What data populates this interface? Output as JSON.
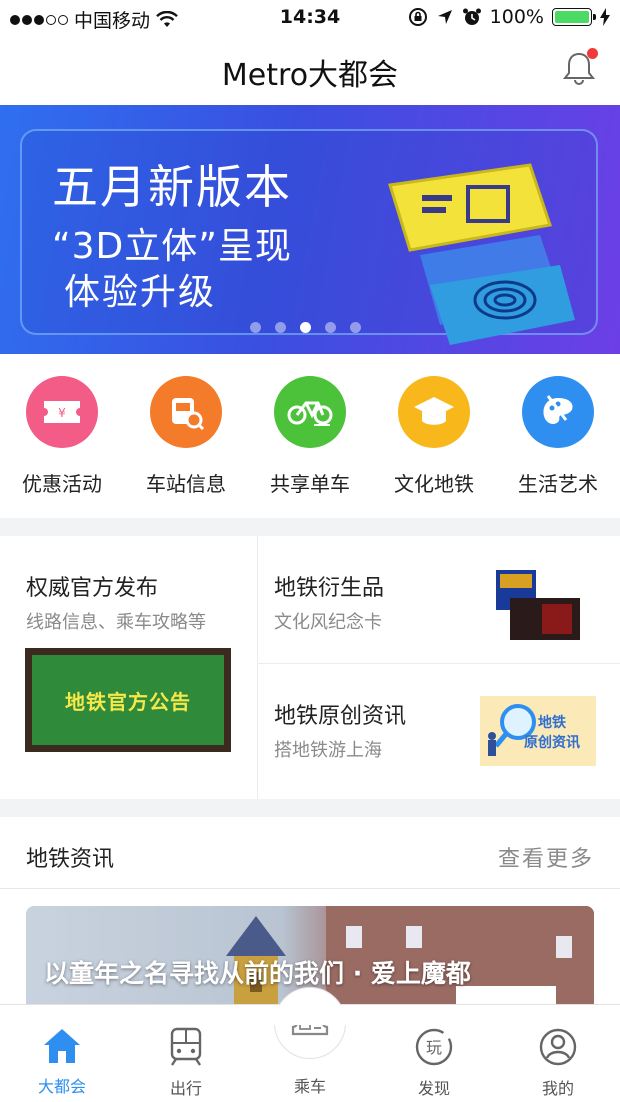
{
  "status_bar": {
    "carrier": "中国移动",
    "time": "14:34",
    "battery": "100%"
  },
  "navbar": {
    "title": "Metro大都会",
    "has_notification_badge": true
  },
  "banner": {
    "line1": "五月新版本",
    "line2": "“3D立体”呈现",
    "line3": "体验升级",
    "page_count": 5,
    "active_page": 3
  },
  "quick_links": [
    {
      "label": "优惠活动",
      "icon": "coupon-icon",
      "color": "#f25c86"
    },
    {
      "label": "车站信息",
      "icon": "station-search-icon",
      "color": "#f47b2a"
    },
    {
      "label": "共享单车",
      "icon": "bicycle-icon",
      "color": "#4cc23a"
    },
    {
      "label": "文化地铁",
      "icon": "graduation-cap-icon",
      "color": "#f8b71a"
    },
    {
      "label": "生活艺术",
      "icon": "palette-icon",
      "color": "#2f8ff0"
    }
  ],
  "features": {
    "official": {
      "title": "权威官方发布",
      "subtitle": "线路信息、乘车攻略等",
      "board_text": "地铁官方公告"
    },
    "merch": {
      "title": "地铁衍生品",
      "subtitle": "文化风纪念卡"
    },
    "original": {
      "title": "地铁原创资讯",
      "subtitle": "搭地铁游上海",
      "thumb_text": [
        "地铁",
        "原创资讯"
      ]
    }
  },
  "news": {
    "section_title": "地铁资讯",
    "more_label": "查看更多",
    "card_caption": "以童年之名寻找从前的我们 · 爱上魔都"
  },
  "tabbar": [
    {
      "label": "大都会",
      "icon": "home-icon",
      "active": true
    },
    {
      "label": "出行",
      "icon": "train-icon",
      "active": false
    },
    {
      "label": "乘车",
      "icon": "ticket-icon",
      "active": false
    },
    {
      "label": "发现",
      "icon": "discover-play-icon",
      "active": false
    },
    {
      "label": "我的",
      "icon": "profile-icon",
      "active": false
    }
  ],
  "colors": {
    "accent": "#2f8ff0",
    "banner_start": "#2f6ff0",
    "banner_end": "#6c3fe6",
    "badge": "#f03a3a"
  }
}
